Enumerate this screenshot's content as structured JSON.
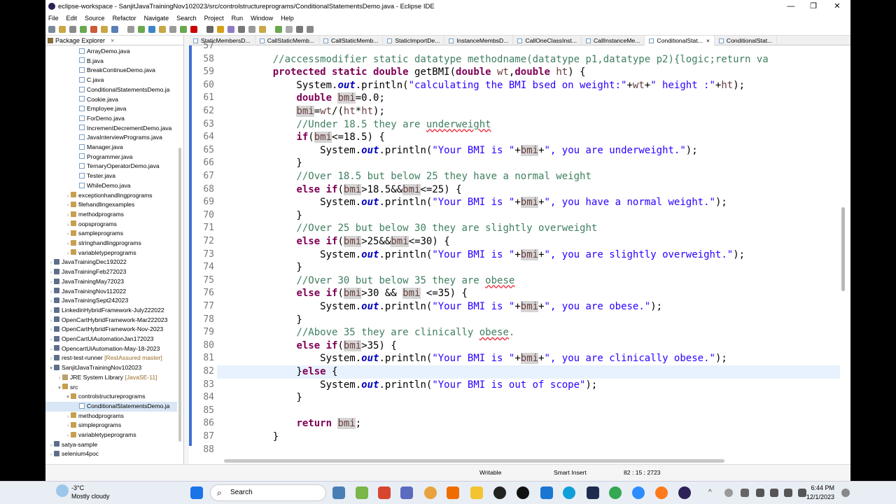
{
  "window": {
    "title": "eclipse-workspace - SanjitJavaTrainingNov102023/src/controlstructureprograms/ConditionalStatementsDemo.java - Eclipse IDE"
  },
  "menu": [
    "File",
    "Edit",
    "Source",
    "Refactor",
    "Navigate",
    "Search",
    "Project",
    "Run",
    "Window",
    "Help"
  ],
  "package_explorer": {
    "title": "Package Explorer",
    "items": [
      {
        "label": "ArrayDemo.java",
        "type": "j",
        "indent": 3
      },
      {
        "label": "B.java",
        "type": "j",
        "indent": 3
      },
      {
        "label": "BreakContinueDemo.java",
        "type": "j",
        "indent": 3
      },
      {
        "label": "C.java",
        "type": "j",
        "indent": 3
      },
      {
        "label": "ConditionalStatementsDemo.ja",
        "type": "j",
        "indent": 3
      },
      {
        "label": "Cookie.java",
        "type": "j",
        "indent": 3
      },
      {
        "label": "Employee.java",
        "type": "j",
        "indent": 3
      },
      {
        "label": "ForDemo.java",
        "type": "j",
        "indent": 3
      },
      {
        "label": "IncrementDecrementDemo.java",
        "type": "j",
        "indent": 3
      },
      {
        "label": "JavaInterviewPrograms.java",
        "type": "j",
        "indent": 3
      },
      {
        "label": "Manager.java",
        "type": "j",
        "indent": 3
      },
      {
        "label": "Programmer.java",
        "type": "j",
        "indent": 3
      },
      {
        "label": "TernaryOperatorDemo.java",
        "type": "j",
        "indent": 3
      },
      {
        "label": "Tester.java",
        "type": "j",
        "indent": 3
      },
      {
        "label": "WhileDemo.java",
        "type": "j",
        "indent": 3
      },
      {
        "label": "exceptionhandlingprograms",
        "type": "p",
        "indent": 2,
        "arrow": ">"
      },
      {
        "label": "filehandlingexamples",
        "type": "p",
        "indent": 2,
        "arrow": ">"
      },
      {
        "label": "methodprograms",
        "type": "p",
        "indent": 2,
        "arrow": ">"
      },
      {
        "label": "oopsprograms",
        "type": "p",
        "indent": 2,
        "arrow": ">"
      },
      {
        "label": "sampleprograms",
        "type": "p",
        "indent": 2,
        "arrow": ">"
      },
      {
        "label": "stringhandlingprograms",
        "type": "p",
        "indent": 2,
        "arrow": ">"
      },
      {
        "label": "variabletypeprograms",
        "type": "p",
        "indent": 2,
        "arrow": ">"
      },
      {
        "label": "JavaTrainingDec192022",
        "type": "pr",
        "indent": 0,
        "arrow": ">"
      },
      {
        "label": "JavaTrainingFeb272023",
        "type": "pr",
        "indent": 0,
        "arrow": ">"
      },
      {
        "label": "JavaTrainingMay72023",
        "type": "pr",
        "indent": 0,
        "arrow": ">"
      },
      {
        "label": "JavaTrainingNov112022",
        "type": "pr",
        "indent": 0,
        "arrow": ">"
      },
      {
        "label": "JavaTrainingSept242023",
        "type": "pr",
        "indent": 0,
        "arrow": ">"
      },
      {
        "label": "LinkedinHybridFramework-July222022",
        "type": "pr",
        "indent": 0,
        "arrow": ">"
      },
      {
        "label": "OpenCartHybridFramework-Mar222023",
        "type": "pr",
        "indent": 0,
        "arrow": ">"
      },
      {
        "label": "OpenCartHybridFramework-Nov-2023",
        "type": "pr",
        "indent": 0,
        "arrow": ">"
      },
      {
        "label": "OpenCartUiAutomationJan172023",
        "type": "pr",
        "indent": 0,
        "arrow": ">"
      },
      {
        "label": "OpencartUiAutomation-May-18-2023",
        "type": "pr",
        "indent": 0,
        "arrow": ">"
      },
      {
        "label": "rest-test-runner",
        "type": "pr",
        "indent": 0,
        "arrow": ">",
        "deco": " [RestAssured master]"
      },
      {
        "label": "SanjitJavaTrainingNov102023",
        "type": "pr",
        "indent": 0,
        "arrow": "v"
      },
      {
        "label": "JRE System Library",
        "type": "lib",
        "indent": 1,
        "arrow": ">",
        "deco": " [JavaSE-11]"
      },
      {
        "label": "src",
        "type": "p",
        "indent": 1,
        "arrow": "v"
      },
      {
        "label": "controlstructureprograms",
        "type": "p",
        "indent": 2,
        "arrow": "v"
      },
      {
        "label": "ConditionalStatementsDemo.ja",
        "type": "j",
        "indent": 3,
        "selected": true
      },
      {
        "label": "methodprograms",
        "type": "p",
        "indent": 2,
        "arrow": ">"
      },
      {
        "label": "simpleprograms",
        "type": "p",
        "indent": 2,
        "arrow": ">"
      },
      {
        "label": "variabletypeprograms",
        "type": "p",
        "indent": 2,
        "arrow": ">"
      },
      {
        "label": "satya-sample",
        "type": "pr",
        "indent": 0,
        "arrow": ">"
      },
      {
        "label": "selenium4poc",
        "type": "pr",
        "indent": 0,
        "arrow": ">"
      }
    ]
  },
  "editor_tabs": [
    {
      "label": "StaticMembersD..."
    },
    {
      "label": "CallStaticMemb..."
    },
    {
      "label": "CallStaticMemb..."
    },
    {
      "label": "StaticImportDe..."
    },
    {
      "label": "InstanceMembsD..."
    },
    {
      "label": "CallOneClassInst..."
    },
    {
      "label": "CallInstanceMe..."
    },
    {
      "label": "ConditionalStat...",
      "active": true,
      "close": "×"
    },
    {
      "label": "ConditionalStat..."
    }
  ],
  "code_lines": [
    {
      "n": "57",
      "html": ""
    },
    {
      "n": "58",
      "html": "    <span class=\"cm\">//accessmodifier static datatype methodname(datatype p1,datatype p2){logic;return va</span>"
    },
    {
      "n": "59",
      "html": "    <span class=\"kw\">protected static double</span> getBMI(<span class=\"kw\">double</span> <span class=\"lvar\">wt</span>,<span class=\"kw\">double</span> <span class=\"lvar\">ht</span>) {"
    },
    {
      "n": "60",
      "html": "        System.<span class=\"fld\">out</span>.println(<span class=\"st\">\"calculating the BMI bsed on weight:\"</span>+<span class=\"lvar\">wt</span>+<span class=\"st\">\" height :\"</span>+<span class=\"lvar\">ht</span>);"
    },
    {
      "n": "61",
      "html": "        <span class=\"kw\">double</span> <span class=\"occ lvar\">bmi</span>=0.0;"
    },
    {
      "n": "62",
      "html": "        <span class=\"occ lvar\">bmi</span>=<span class=\"lvar\">wt</span>/(<span class=\"lvar\">ht</span>*<span class=\"lvar\">ht</span>);"
    },
    {
      "n": "63",
      "html": "        <span class=\"cm\">//Under 18.5 they are <span class=\"sq\">underweight</span></span>"
    },
    {
      "n": "64",
      "html": "        <span class=\"kw\">if</span>(<span class=\"occ lvar\">bmi</span>&lt;=18.5) {"
    },
    {
      "n": "65",
      "html": "            System.<span class=\"fld\">out</span>.println(<span class=\"st\">\"Your BMI is \"</span>+<span class=\"occ lvar\">bmi</span>+<span class=\"st\">\", you are underweight.\"</span>);"
    },
    {
      "n": "66",
      "html": "        }"
    },
    {
      "n": "67",
      "html": "        <span class=\"cm\">//Over 18.5 but below 25 they have a normal weight</span>"
    },
    {
      "n": "68",
      "html": "        <span class=\"kw\">else if</span>(<span class=\"occ lvar\">bmi</span>&gt;18.5&amp;&amp;<span class=\"occ lvar\">bmi</span>&lt;=25) {"
    },
    {
      "n": "69",
      "html": "            System.<span class=\"fld\">out</span>.println(<span class=\"st\">\"Your BMI is \"</span>+<span class=\"occ lvar\">bmi</span>+<span class=\"st\">\", you have a normal weight.\"</span>);"
    },
    {
      "n": "70",
      "html": "        }"
    },
    {
      "n": "71",
      "html": "        <span class=\"cm\">//Over 25 but below 30 they are slightly overweight</span>"
    },
    {
      "n": "72",
      "html": "        <span class=\"kw\">else if</span>(<span class=\"occ lvar\">bmi</span>&gt;25&amp;&amp;<span class=\"occ lvar\">bmi</span>&lt;=30) {"
    },
    {
      "n": "73",
      "html": "            System.<span class=\"fld\">out</span>.println(<span class=\"st\">\"Your BMI is \"</span>+<span class=\"occ lvar\">bmi</span>+<span class=\"st\">\", you are slightly overweight.\"</span>);"
    },
    {
      "n": "74",
      "html": "        }"
    },
    {
      "n": "75",
      "html": "        <span class=\"cm\">//Over 30 but below 35 they are <span class=\"sq\">obese</span></span>"
    },
    {
      "n": "76",
      "html": "        <span class=\"kw\">else if</span>(<span class=\"occ lvar\">bmi</span>&gt;30 &amp;&amp; <span class=\"occ lvar\">bmi</span> &lt;=35) {"
    },
    {
      "n": "77",
      "html": "            System.<span class=\"fld\">out</span>.println(<span class=\"st\">\"Your BMI is \"</span>+<span class=\"occ lvar\">bmi</span>+<span class=\"st\">\", you are obese.\"</span>);"
    },
    {
      "n": "78",
      "html": "        }"
    },
    {
      "n": "79",
      "html": "        <span class=\"cm\">//Above 35 they are clinically <span class=\"sq\">obese</span>.</span>"
    },
    {
      "n": "80",
      "html": "        <span class=\"kw\">else if</span>(<span class=\"occ lvar\">bmi</span>&gt;35) {"
    },
    {
      "n": "81",
      "html": "            System.<span class=\"fld\">out</span>.println(<span class=\"st\">\"Your BMI is \"</span>+<span class=\"occ lvar\">bmi</span>+<span class=\"st\">\", you are clinically obese.\"</span>);"
    },
    {
      "n": "82",
      "html": "        }<span class=\"kw\">else</span> {",
      "current": true
    },
    {
      "n": "83",
      "html": "            System.<span class=\"fld\">out</span>.println(<span class=\"st\">\"Your BMI is out of scope\"</span>);"
    },
    {
      "n": "84",
      "html": "        }"
    },
    {
      "n": "85",
      "html": ""
    },
    {
      "n": "86",
      "html": "        <span class=\"kw\">return</span> <span class=\"occ lvar\">bmi</span>;"
    },
    {
      "n": "87",
      "html": "    }"
    },
    {
      "n": "88",
      "html": ""
    }
  ],
  "status": {
    "mode": "Writable",
    "insert": "Smart Insert",
    "position": "82 : 15 : 2723"
  },
  "taskbar": {
    "temp": "-3°C",
    "weather": "Mostly cloudy",
    "search": "Search",
    "time": "6:44 PM",
    "date": "12/1/2023"
  }
}
